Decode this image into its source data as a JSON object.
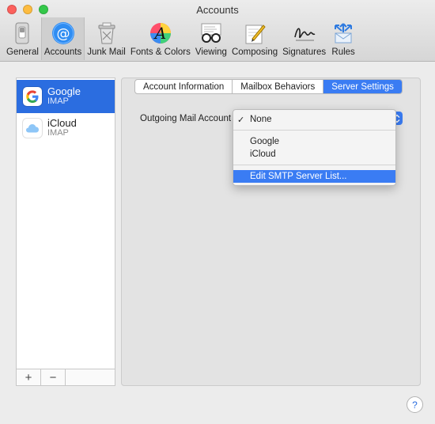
{
  "window": {
    "title": "Accounts"
  },
  "toolbar": {
    "items": [
      {
        "label": "General",
        "icon": "general-switch-icon"
      },
      {
        "label": "Accounts",
        "icon": "at-sign-icon",
        "active": true
      },
      {
        "label": "Junk Mail",
        "icon": "trash-can-icon"
      },
      {
        "label": "Fonts & Colors",
        "icon": "font-palette-icon"
      },
      {
        "label": "Viewing",
        "icon": "glasses-icon"
      },
      {
        "label": "Composing",
        "icon": "pencil-paper-icon"
      },
      {
        "label": "Signatures",
        "icon": "signature-icon"
      },
      {
        "label": "Rules",
        "icon": "rules-arrows-icon"
      }
    ]
  },
  "accounts": [
    {
      "name": "Google",
      "type": "IMAP",
      "selected": true,
      "icon": "google-icon"
    },
    {
      "name": "iCloud",
      "type": "IMAP",
      "selected": false,
      "icon": "icloud-icon"
    }
  ],
  "list_footer": {
    "add_label": "+",
    "remove_label": "−"
  },
  "tabs": [
    {
      "label": "Account Information"
    },
    {
      "label": "Mailbox Behaviors"
    },
    {
      "label": "Server Settings",
      "active": true
    }
  ],
  "server_settings": {
    "outgoing_label": "Outgoing Mail Account"
  },
  "dropdown": {
    "items": [
      {
        "label": "None",
        "checked": true
      },
      {
        "label": "Google"
      },
      {
        "label": "iCloud"
      },
      {
        "label": "Edit SMTP Server List...",
        "highlighted": true
      }
    ]
  },
  "help": {
    "label": "?"
  },
  "colors": {
    "accent": "#3a7cf3",
    "selection": "#2b6de0"
  }
}
